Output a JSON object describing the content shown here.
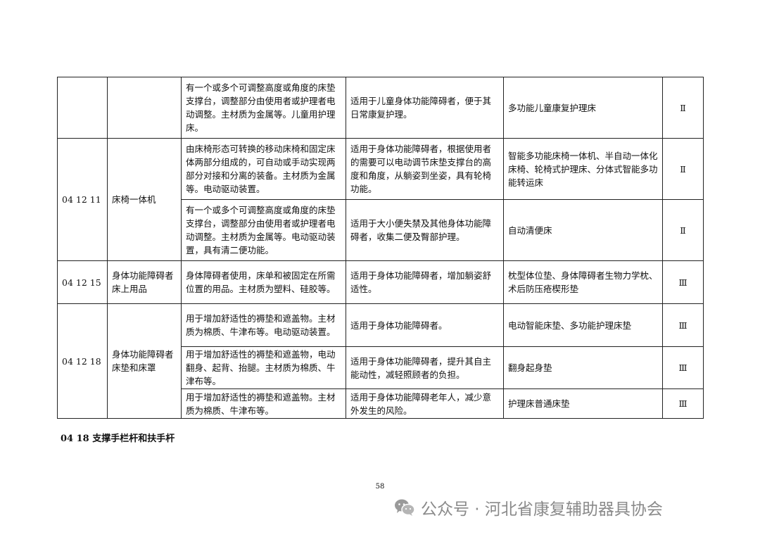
{
  "table": {
    "rows": [
      {
        "code": "",
        "name": "",
        "description": "有一个或多个可调整高度或角度的床垫支撑台，调整部分由使用者或护理者电动调整。主材质为金属等。儿童用护理床。",
        "applicable": "适用于儿童身体功能障碍者，便于其日常康复护理。",
        "product": "多功能儿童康复护理床",
        "class": "Ⅱ"
      },
      {
        "code": "04 12 11",
        "name": "床椅一体机",
        "description": "由床椅形态可转换的移动床椅和固定床体两部分组成的，可自动或手动实现两部分对接和分离的装备。主材质为金属等。电动驱动装置。",
        "applicable": "适用于身体功能障碍者，根据使用者的需要可以电动调节床垫支撑台的高度和角度，从躺姿到坐姿，具有轮椅功能。",
        "product": "智能多功能床椅一体机、半自动一体化床椅、轮椅式护理床、分体式智能多功能转运床",
        "class": "Ⅱ"
      },
      {
        "description": "有一个或多个可调整高度或角度的床垫支撑台，调整部分由使用者或护理者电动调整。主材质为金属等。电动驱动装置，具有清二便功能。",
        "applicable": "适用于大小便失禁及其他身体功能障碍者，收集二便及臀部护理。",
        "product": "自动清便床",
        "class": "Ⅱ"
      },
      {
        "code": "04 12 15",
        "name": "身体功能障碍者床上用品",
        "description": "身体障碍者使用，床单和被固定在所需位置的用品。主材质为塑料、硅胶等。",
        "applicable": "适用于身体功能障碍者，增加躺姿舒适性。",
        "product": "枕型体位垫、身体障碍者生物力学枕、术后防压疮楔形垫",
        "class": "Ⅲ"
      },
      {
        "code": "04 12 18",
        "name": "身体功能障碍者床垫和床罩",
        "description": "用于增加舒适性的褥垫和遮盖物。主材质为棉质、牛津布等。电动驱动装置。",
        "applicable": "适用于身体功能障碍者。",
        "product": "电动智能床垫、多功能护理床垫",
        "class": "Ⅲ"
      },
      {
        "description": "用于增加舒适性的褥垫和遮盖物，电动翻身、起背、抬腿。主材质为棉质、牛津布等。",
        "applicable": "适用于身体功能障碍者，提升其自主能动性，减轻照顾者的负担。",
        "product": "翻身起身垫",
        "class": "Ⅲ"
      },
      {
        "description": "用于增加舒适性的褥垫和遮盖物。主材质为棉质、牛津布等。",
        "applicable": "适用于身体功能障碍老年人，减少意外发生的风险。",
        "product": "护理床普通床垫",
        "class": "Ⅲ"
      }
    ]
  },
  "section_heading": "04 18  支撑手栏杆和扶手杆",
  "page_number": "58",
  "watermark": {
    "icon": "wechat-icon",
    "text": "公众号 · 河北省康复辅助器具协会"
  }
}
